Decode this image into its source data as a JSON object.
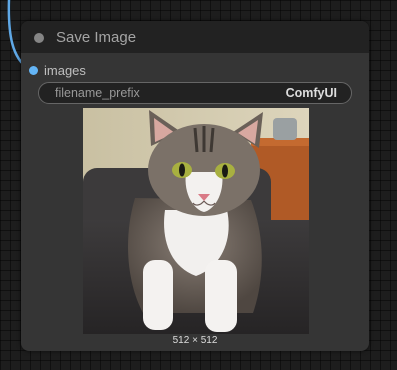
{
  "node": {
    "title": "Save Image",
    "input_label": "images",
    "widget": {
      "name": "filename_prefix",
      "value": "ComfyUI"
    },
    "image_size": "512 × 512"
  },
  "colors": {
    "input_slot": "#64b5f6",
    "link_wire": "#5fa8e6"
  }
}
